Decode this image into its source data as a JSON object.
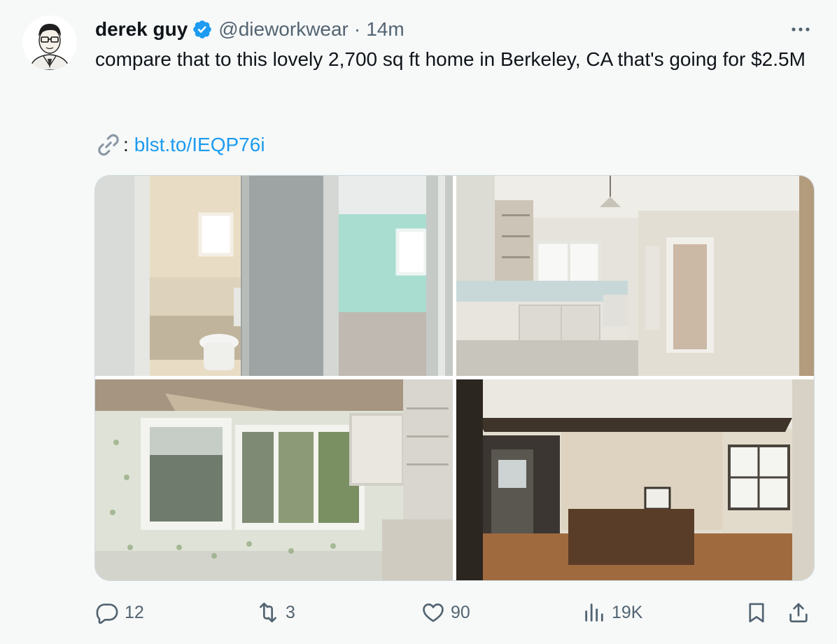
{
  "author": {
    "name": "derek guy",
    "handle": "@dieworkwear",
    "separator": "·",
    "time": "14m",
    "verified": true
  },
  "tweet": {
    "text": "compare that to this lovely 2,700 sq ft home in Berkeley, CA that's going for $2.5M",
    "link_prefix": ":",
    "link_text": "blst.to/IEQP76i"
  },
  "media": {
    "photos": [
      {
        "subject": "bathroom with toilet and doorway to teal bedroom"
      },
      {
        "subject": "damaged kitchen with open cabinets"
      },
      {
        "subject": "sunroom with floral wallpaper and windows"
      },
      {
        "subject": "hallway with wood wainscoting and staircase rail"
      }
    ]
  },
  "actions": {
    "replies": "12",
    "reposts": "3",
    "likes": "90",
    "views": "19K"
  },
  "icons": [
    "verified-badge-icon",
    "more-icon",
    "link-icon",
    "reply-icon",
    "repost-icon",
    "like-icon",
    "views-icon",
    "bookmark-icon",
    "share-icon"
  ],
  "colors": {
    "background": "#f7f9f9",
    "text": "#0f1419",
    "secondary": "#536471",
    "accent": "#1d9bf0"
  }
}
